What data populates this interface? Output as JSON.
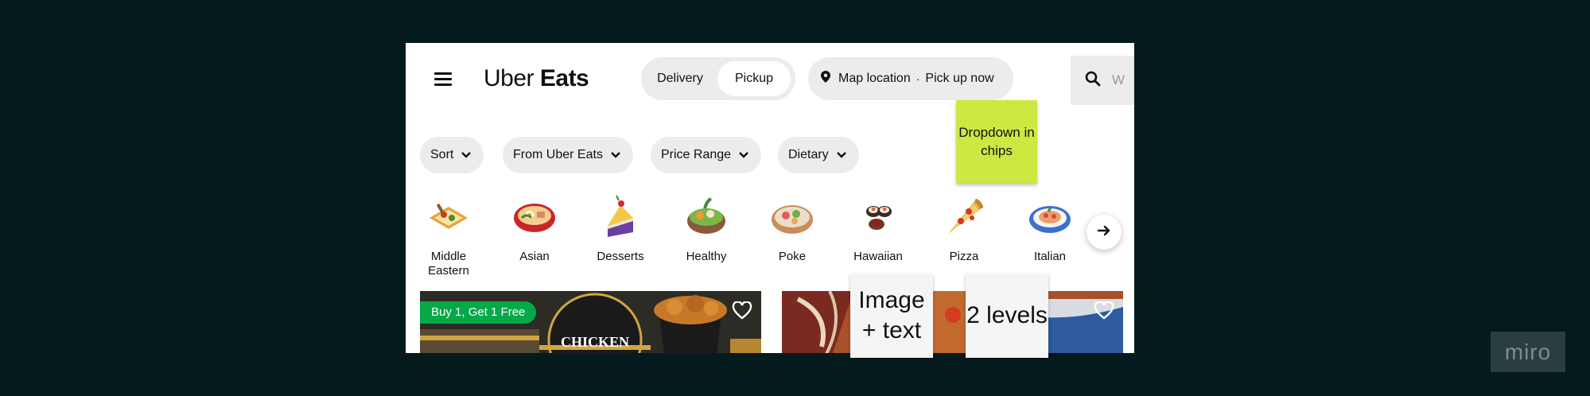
{
  "header": {
    "logo_light": "Uber",
    "logo_bold": "Eats",
    "mode_delivery": "Delivery",
    "mode_pickup": "Pickup",
    "location_text": "Map location",
    "location_separator": "·",
    "location_time": "Pick up now",
    "search_placeholder": "W"
  },
  "filters": [
    {
      "label": "Sort"
    },
    {
      "label": "From Uber Eats"
    },
    {
      "label": "Price Range"
    },
    {
      "label": "Dietary"
    }
  ],
  "categories": [
    {
      "label": "Middle Eastern",
      "icon": "middle-eastern-food-icon"
    },
    {
      "label": "Asian",
      "icon": "asian-food-icon"
    },
    {
      "label": "Desserts",
      "icon": "desserts-icon"
    },
    {
      "label": "Healthy",
      "icon": "healthy-food-icon"
    },
    {
      "label": "Poke",
      "icon": "poke-icon"
    },
    {
      "label": "Hawaiian",
      "icon": "hawaiian-food-icon"
    },
    {
      "label": "Pizza",
      "icon": "pizza-icon"
    },
    {
      "label": "Italian",
      "icon": "italian-food-icon"
    }
  ],
  "cards": [
    {
      "promo": "Buy 1, Get 1 Free",
      "brand": "CHICKEN"
    },
    {
      "promo": ""
    }
  ],
  "annotations": {
    "dropdown_note": "Dropdown in chips",
    "image_text_note": "Image + text",
    "levels_note": "2 levels"
  },
  "watermark": "miro",
  "colors": {
    "background": "#051a1c",
    "promo_green": "#06a948",
    "sticky_green": "#cee741",
    "chip_gray": "#ececec"
  }
}
